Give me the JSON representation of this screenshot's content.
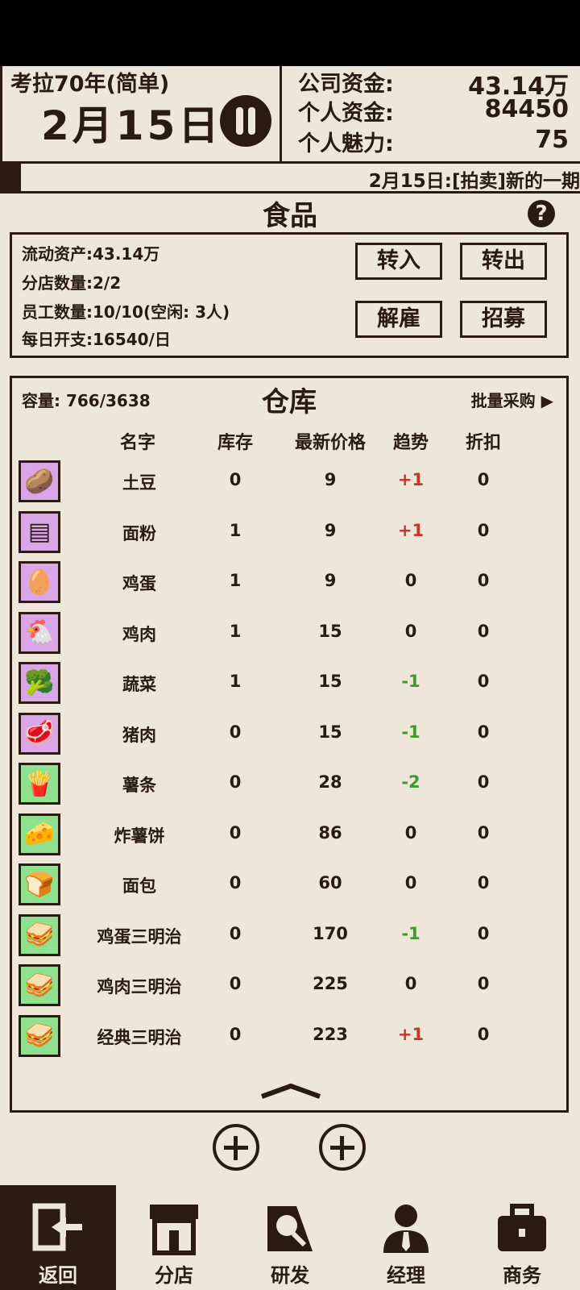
{
  "header": {
    "game_title": "考拉70年(简单)",
    "date": "2月15日",
    "stats": [
      {
        "label": "公司资金:",
        "value": "43.14万"
      },
      {
        "label": "个人资金:",
        "value": "84450"
      },
      {
        "label": "个人魅力:",
        "value": "75"
      }
    ]
  },
  "ticker": {
    "text": "2月15日:[拍卖]新的一期"
  },
  "section": {
    "title": "食品",
    "help": "?"
  },
  "info": {
    "lines": [
      "流动资产:43.14万",
      "分店数量:2/2",
      "员工数量:10/10(空闲: 3人)",
      "每日开支:16540/日"
    ],
    "buttons": {
      "transfer_in": "转入",
      "transfer_out": "转出",
      "fire": "解雇",
      "recruit": "招募"
    }
  },
  "warehouse": {
    "capacity": "容量: 766/3638",
    "title": "仓库",
    "bulk_buy": "批量采购 ▶",
    "columns": [
      "名字",
      "库存",
      "最新价格",
      "趋势",
      "折扣"
    ],
    "rows": [
      {
        "icon": "potato-icon",
        "glyph": "🥔",
        "bg": "#d9a6e8",
        "name": "土豆",
        "stock": "0",
        "price": "9",
        "trend": "+1",
        "trend_dir": "up",
        "discount": "0"
      },
      {
        "icon": "flour-icon",
        "glyph": "▤",
        "bg": "#d9a6e8",
        "name": "面粉",
        "stock": "1",
        "price": "9",
        "trend": "+1",
        "trend_dir": "up",
        "discount": "0"
      },
      {
        "icon": "egg-icon",
        "glyph": "🥚",
        "bg": "#d9a6e8",
        "name": "鸡蛋",
        "stock": "1",
        "price": "9",
        "trend": "0",
        "trend_dir": "flat",
        "discount": "0"
      },
      {
        "icon": "chicken-icon",
        "glyph": "🐔",
        "bg": "#d9a6e8",
        "name": "鸡肉",
        "stock": "1",
        "price": "15",
        "trend": "0",
        "trend_dir": "flat",
        "discount": "0"
      },
      {
        "icon": "broccoli-icon",
        "glyph": "🥦",
        "bg": "#d9a6e8",
        "name": "蔬菜",
        "stock": "1",
        "price": "15",
        "trend": "-1",
        "trend_dir": "down",
        "discount": "0"
      },
      {
        "icon": "pork-icon",
        "glyph": "🥩",
        "bg": "#d9a6e8",
        "name": "猪肉",
        "stock": "0",
        "price": "15",
        "trend": "-1",
        "trend_dir": "down",
        "discount": "0"
      },
      {
        "icon": "fries-icon",
        "glyph": "🍟",
        "bg": "#8fe08f",
        "name": "薯条",
        "stock": "0",
        "price": "28",
        "trend": "-2",
        "trend_dir": "down",
        "discount": "0"
      },
      {
        "icon": "hashbrown-icon",
        "glyph": "🧀",
        "bg": "#8fe08f",
        "name": "炸薯饼",
        "stock": "0",
        "price": "86",
        "trend": "0",
        "trend_dir": "flat",
        "discount": "0"
      },
      {
        "icon": "bread-icon",
        "glyph": "🍞",
        "bg": "#8fe08f",
        "name": "面包",
        "stock": "0",
        "price": "60",
        "trend": "0",
        "trend_dir": "flat",
        "discount": "0"
      },
      {
        "icon": "sandwich-icon",
        "glyph": "🥪",
        "bg": "#8fe08f",
        "name": "鸡蛋三明治",
        "stock": "0",
        "price": "170",
        "trend": "-1",
        "trend_dir": "down",
        "discount": "0"
      },
      {
        "icon": "sandwich-icon",
        "glyph": "🥪",
        "bg": "#8fe08f",
        "name": "鸡肉三明治",
        "stock": "0",
        "price": "225",
        "trend": "0",
        "trend_dir": "flat",
        "discount": "0"
      },
      {
        "icon": "sandwich-icon",
        "glyph": "🥪",
        "bg": "#8fe08f",
        "name": "经典三明治",
        "stock": "0",
        "price": "223",
        "trend": "+1",
        "trend_dir": "up",
        "discount": "0"
      }
    ]
  },
  "nav": [
    {
      "id": "back",
      "label": "返回"
    },
    {
      "id": "branch",
      "label": "分店"
    },
    {
      "id": "research",
      "label": "研发"
    },
    {
      "id": "manager",
      "label": "经理"
    },
    {
      "id": "business",
      "label": "商务"
    }
  ]
}
